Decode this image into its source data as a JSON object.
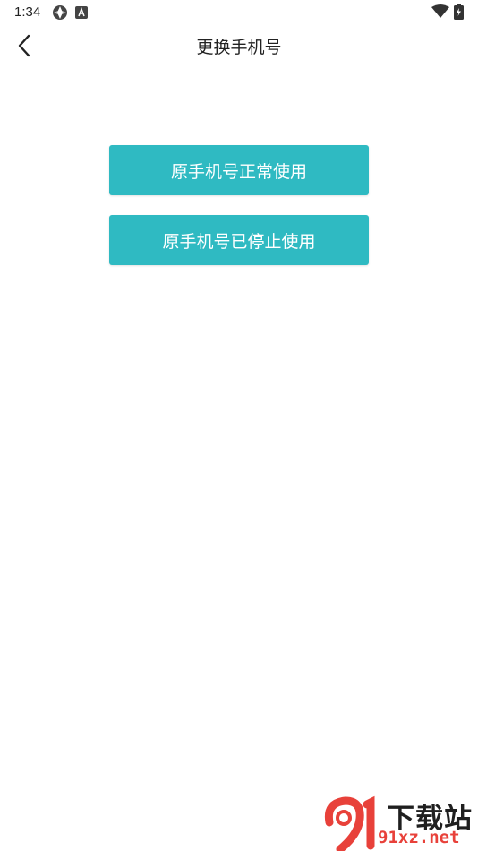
{
  "status_bar": {
    "time": "1:34",
    "icons": [
      "app-notification-icon",
      "a-badge-icon",
      "wifi-icon",
      "battery-charging-icon"
    ]
  },
  "header": {
    "title": "更换手机号",
    "back_icon": "chevron-left-icon"
  },
  "options": [
    {
      "label": "原手机号正常使用"
    },
    {
      "label": "原手机号已停止使用"
    }
  ],
  "watermark": {
    "text": "下载站",
    "url": "91xz.net"
  },
  "colors": {
    "accent": "#2fbac2",
    "background": "#ffffff",
    "watermark_red": "#e8413a"
  }
}
